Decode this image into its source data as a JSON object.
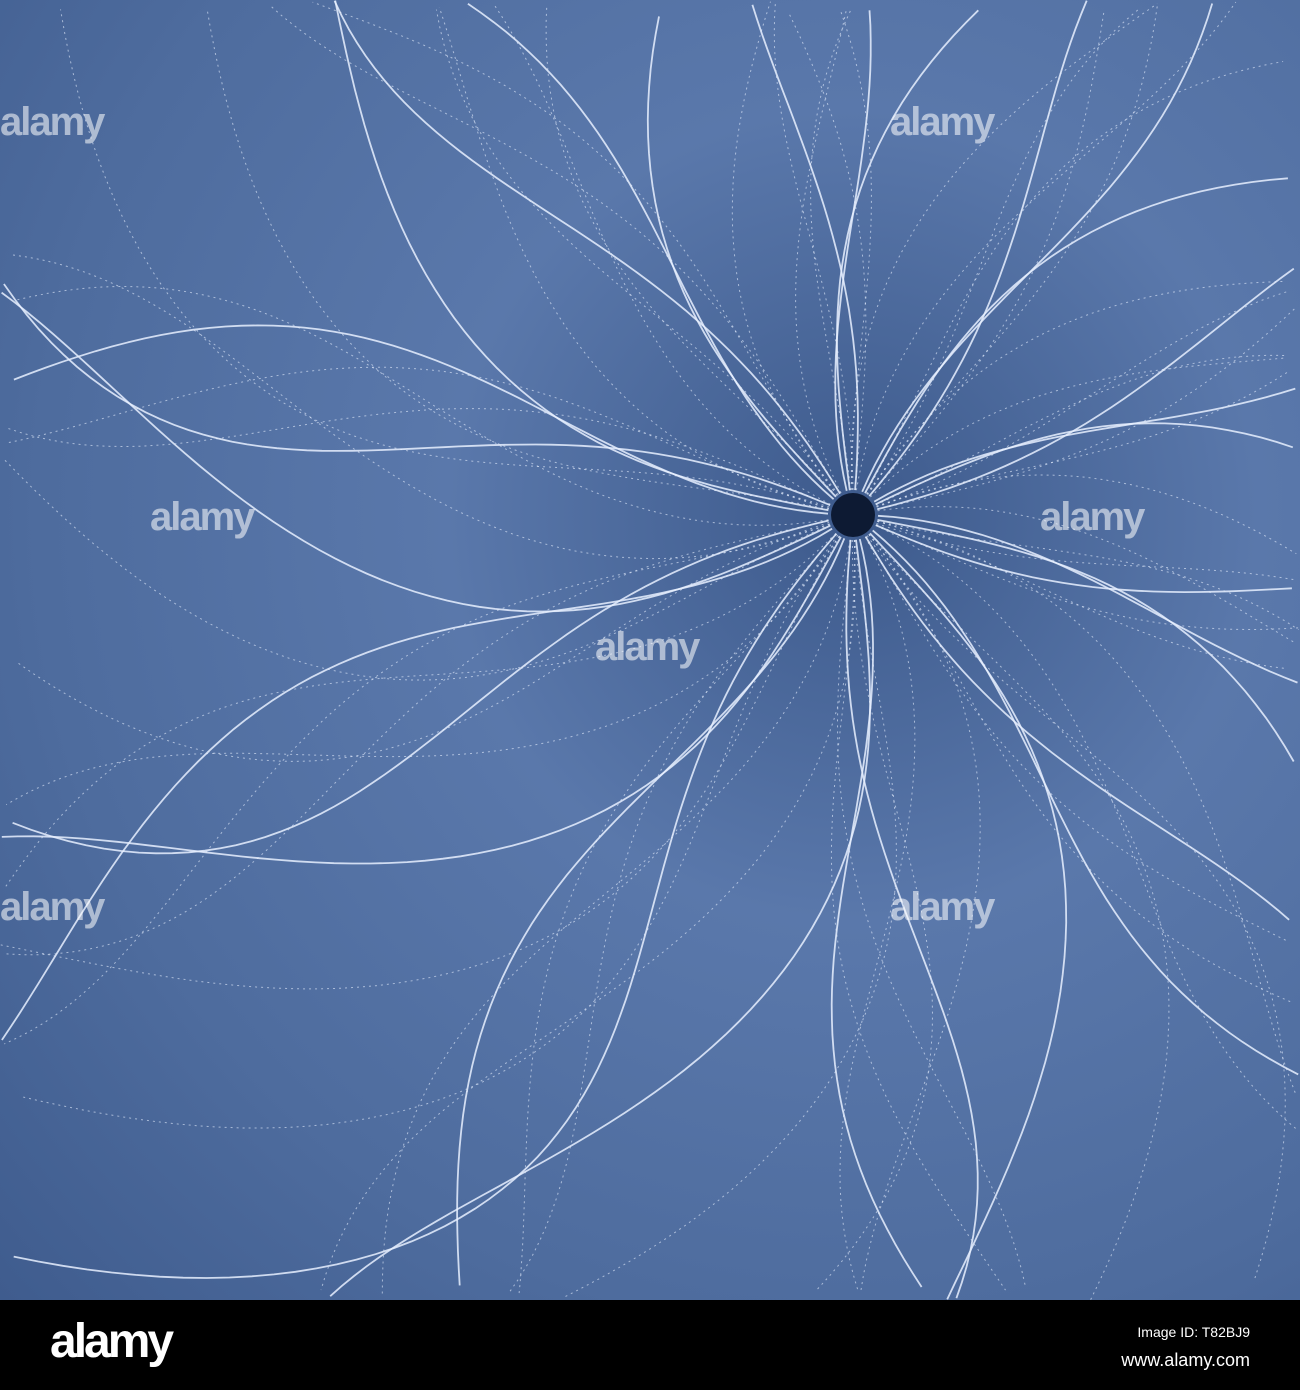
{
  "image": {
    "colors": {
      "background": "#4e6c9e",
      "lines": "#e8f0ff",
      "center": "#0d1a33"
    }
  },
  "watermark": "alamy",
  "footer": {
    "logo": "alamy",
    "image_id": "Image ID: T82BJ9",
    "url": "www.alamy.com"
  }
}
